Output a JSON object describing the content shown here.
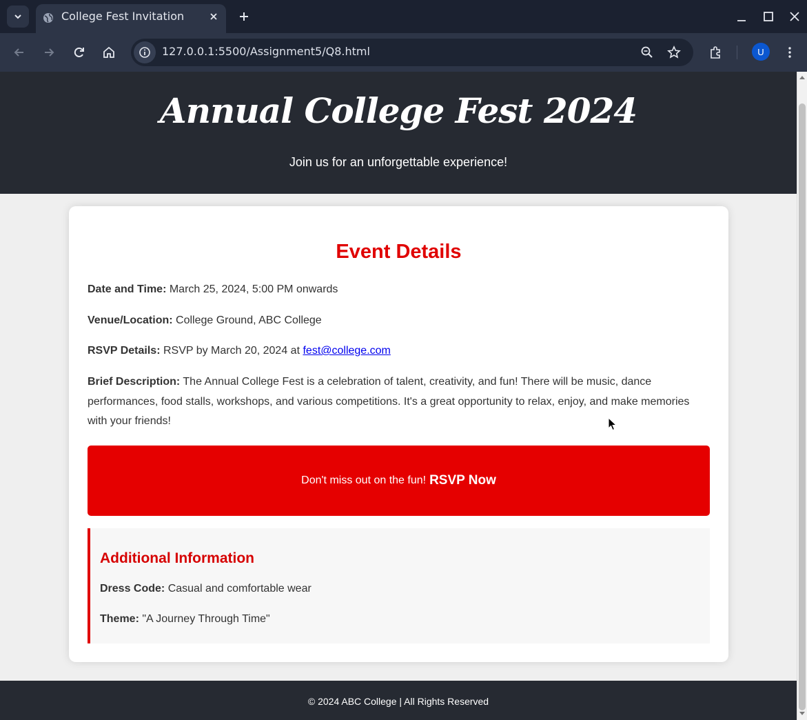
{
  "browser": {
    "tab_title": "College Fest Invitation",
    "url": "127.0.0.1:5500/Assignment5/Q8.html",
    "profile_initial": "U"
  },
  "page": {
    "hero": {
      "title": "Annual College Fest 2024",
      "subtitle": "Join us for an unforgettable experience!"
    },
    "event": {
      "heading": "Event Details",
      "date_label": "Date and Time:",
      "date_value": " March 25, 2024, 5:00 PM onwards",
      "venue_label": "Venue/Location:",
      "venue_value": " College Ground, ABC College",
      "rsvp_label": "RSVP Details:",
      "rsvp_value": " RSVP by March 20, 2024 at ",
      "rsvp_email": "fest@college.com",
      "desc_label": "Brief Description:",
      "desc_value": " The Annual College Fest is a celebration of talent, creativity, and fun! There will be music, dance performances, food stalls, workshops, and various competitions. It's a great opportunity to relax, enjoy, and make memories with your friends!"
    },
    "cta": {
      "text": "Don't miss out on the fun!",
      "link": "RSVP Now"
    },
    "additional": {
      "heading": "Additional Information",
      "dress_label": "Dress Code:",
      "dress_value": " Casual and comfortable wear",
      "theme_label": "Theme:",
      "theme_value": " \"A Journey Through Time\""
    },
    "footer": "© 2024 ABC College | All Rights Reserved"
  },
  "colors": {
    "accent": "#e00000",
    "dark_header": "#262a32",
    "link": "#0000ee"
  }
}
